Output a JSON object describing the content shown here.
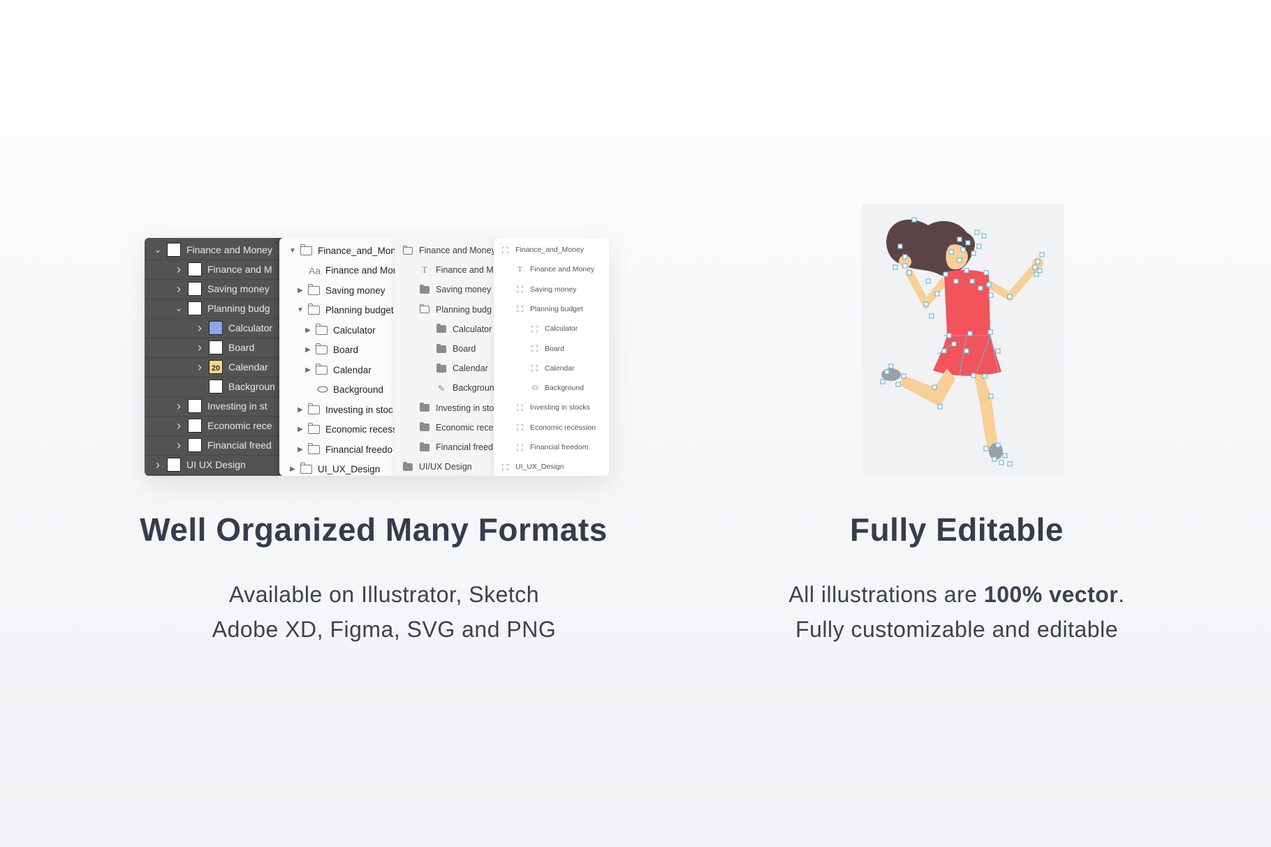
{
  "layers_panels": {
    "illustrator": {
      "rows": [
        {
          "chev": "v",
          "label": "Finance and Money",
          "indent": 0
        },
        {
          "chev": ">",
          "label": "Finance and M",
          "indent": 1
        },
        {
          "chev": ">",
          "label": "Saving money",
          "indent": 1
        },
        {
          "chev": "v",
          "label": "Planning budg",
          "indent": 1
        },
        {
          "chev": ">",
          "label": "Calculator",
          "indent": 2
        },
        {
          "chev": ">",
          "label": "Board",
          "indent": 2
        },
        {
          "chev": ">",
          "label": "Calendar",
          "indent": 2
        },
        {
          "chev": "",
          "label": "Backgroun",
          "indent": 2
        },
        {
          "chev": ">",
          "label": "Investing in st",
          "indent": 1
        },
        {
          "chev": ">",
          "label": "Economic rece",
          "indent": 1
        },
        {
          "chev": ">",
          "label": "Financial freed",
          "indent": 1
        },
        {
          "chev": ">",
          "label": "UI UX Design",
          "indent": 0
        }
      ],
      "calendar_thumb_number": "20"
    },
    "sketch": {
      "rows": [
        {
          "tri": "open",
          "icon": "folder",
          "label": "Finance_and_Mone",
          "indent": 0
        },
        {
          "tri": "",
          "icon": "text",
          "label": "Finance and Mon",
          "indent": 1
        },
        {
          "tri": "closed",
          "icon": "folder",
          "label": "Saving money",
          "indent": 1
        },
        {
          "tri": "open",
          "icon": "folder",
          "label": "Planning budget",
          "indent": 1
        },
        {
          "tri": "closed",
          "icon": "folder",
          "label": "Calculator",
          "indent": 2
        },
        {
          "tri": "closed",
          "icon": "folder",
          "label": "Board",
          "indent": 2
        },
        {
          "tri": "closed",
          "icon": "folder",
          "label": "Calendar",
          "indent": 2
        },
        {
          "tri": "",
          "icon": "shape",
          "label": "Background",
          "indent": 2
        },
        {
          "tri": "closed",
          "icon": "folder",
          "label": "Investing in stoc",
          "indent": 1
        },
        {
          "tri": "closed",
          "icon": "folder",
          "label": "Economic recess",
          "indent": 1
        },
        {
          "tri": "closed",
          "icon": "folder",
          "label": "Financial freedo",
          "indent": 1
        },
        {
          "tri": "closed",
          "icon": "folder",
          "label": "UI_UX_Design",
          "indent": 0
        }
      ],
      "text_icon_glyph": "Aa"
    },
    "xd": {
      "rows": [
        {
          "icon": "folder-outline",
          "label": "Finance and Money",
          "indent": 0
        },
        {
          "icon": "text",
          "label": "Finance and M",
          "indent": 1
        },
        {
          "icon": "folder",
          "label": "Saving money",
          "indent": 1
        },
        {
          "icon": "folder-outline",
          "label": "Planning budg",
          "indent": 1
        },
        {
          "icon": "folder",
          "label": "Calculator",
          "indent": 2
        },
        {
          "icon": "folder",
          "label": "Board",
          "indent": 2
        },
        {
          "icon": "folder",
          "label": "Calendar",
          "indent": 2
        },
        {
          "icon": "pen",
          "label": "Backgroun",
          "indent": 2
        },
        {
          "icon": "folder",
          "label": "Investing in sto",
          "indent": 1
        },
        {
          "icon": "folder",
          "label": "Economic rece",
          "indent": 1
        },
        {
          "icon": "folder",
          "label": "Financial freed",
          "indent": 1
        },
        {
          "icon": "folder",
          "label": "UI/UX Design",
          "indent": 0
        }
      ],
      "text_icon_glyph": "T"
    },
    "figma": {
      "rows": [
        {
          "icon": "frame",
          "label": "Finance_and_Money",
          "indent": 0
        },
        {
          "icon": "text",
          "label": "Finance and Money",
          "indent": 1
        },
        {
          "icon": "frame",
          "label": "Saving money",
          "indent": 1
        },
        {
          "icon": "frame",
          "label": "Planning budget",
          "indent": 1
        },
        {
          "icon": "frame",
          "label": "Calculator",
          "indent": 2
        },
        {
          "icon": "frame",
          "label": "Board",
          "indent": 2
        },
        {
          "icon": "frame",
          "label": "Calendar",
          "indent": 2
        },
        {
          "icon": "ellipse",
          "label": "Background",
          "indent": 2
        },
        {
          "icon": "frame",
          "label": "Investing in stocks",
          "indent": 1
        },
        {
          "icon": "frame",
          "label": "Economic recession",
          "indent": 1
        },
        {
          "icon": "frame",
          "label": "Financial freedom",
          "indent": 1
        },
        {
          "icon": "frame",
          "label": "UI_UX_Design",
          "indent": 0
        }
      ],
      "text_icon_glyph": "T"
    }
  },
  "left_feature": {
    "title": "Well Organized Many Formats",
    "line1": "Available on Illustrator, Sketch",
    "line2": "Adobe XD, Figma, SVG and PNG"
  },
  "right_feature": {
    "title": "Fully Editable",
    "line1_prefix": "All illustrations are ",
    "line1_bold": "100% vector",
    "line1_suffix": ".",
    "line2": "Fully customizable and editable"
  },
  "colors": {
    "heading": "#373b4c",
    "dress": "#f2545b",
    "skin": "#f9cf98",
    "hair": "#5b4447",
    "anchor": "#6fb7d6",
    "illustrator_panel": "#535353"
  },
  "icons": [
    "chevron-down-icon",
    "chevron-right-icon",
    "folder-icon",
    "text-icon",
    "frame-icon",
    "pen-icon",
    "ellipse-icon"
  ]
}
